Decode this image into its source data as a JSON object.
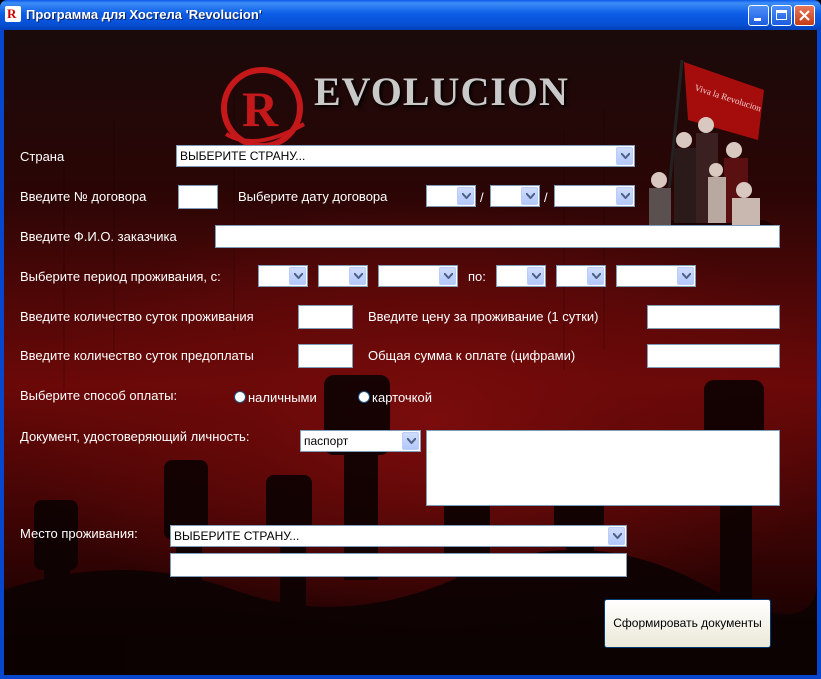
{
  "window": {
    "title": "Программа для Хостела 'Revolucion'"
  },
  "logo": {
    "letter": "R",
    "text": "EVOLUCION"
  },
  "banner": {
    "flag_text": "Viva la Revolucion"
  },
  "form": {
    "country_label": "Страна",
    "country_value": "ВЫБЕРИТЕ СТРАНУ...",
    "contract_no_label": "Введите № договора",
    "contract_no_value": "",
    "contract_date_label": "Выберите дату договора",
    "date_sep": "/",
    "customer_name_label": "Введите Ф.И.О. заказчика",
    "customer_name_value": "",
    "period_label": "Выберите период проживания, с:",
    "period_to_label": "по:",
    "nights_label": "Введите количество суток проживания",
    "nights_value": "",
    "price_label": "Введите цену за проживание (1 сутки)",
    "price_value": "",
    "prepaid_nights_label": "Введите количество суток предоплаты",
    "prepaid_nights_value": "",
    "total_label": "Общая сумма к оплате (цифрами)",
    "total_value": "",
    "payment_label": "Выберите способ оплаты:",
    "payment_cash": "наличными",
    "payment_card": "карточкой",
    "document_label": "Документ, удостоверяющий личность:",
    "document_value": "паспорт",
    "residence_label": "Место проживания:",
    "residence_value": "ВЫБЕРИТЕ СТРАНУ...",
    "address_value": "",
    "submit_label": "Сформировать документы"
  },
  "colors": {
    "titlebar": "#0a5ae8",
    "background_red": "#6b0808",
    "logo_red": "#c4181a"
  }
}
